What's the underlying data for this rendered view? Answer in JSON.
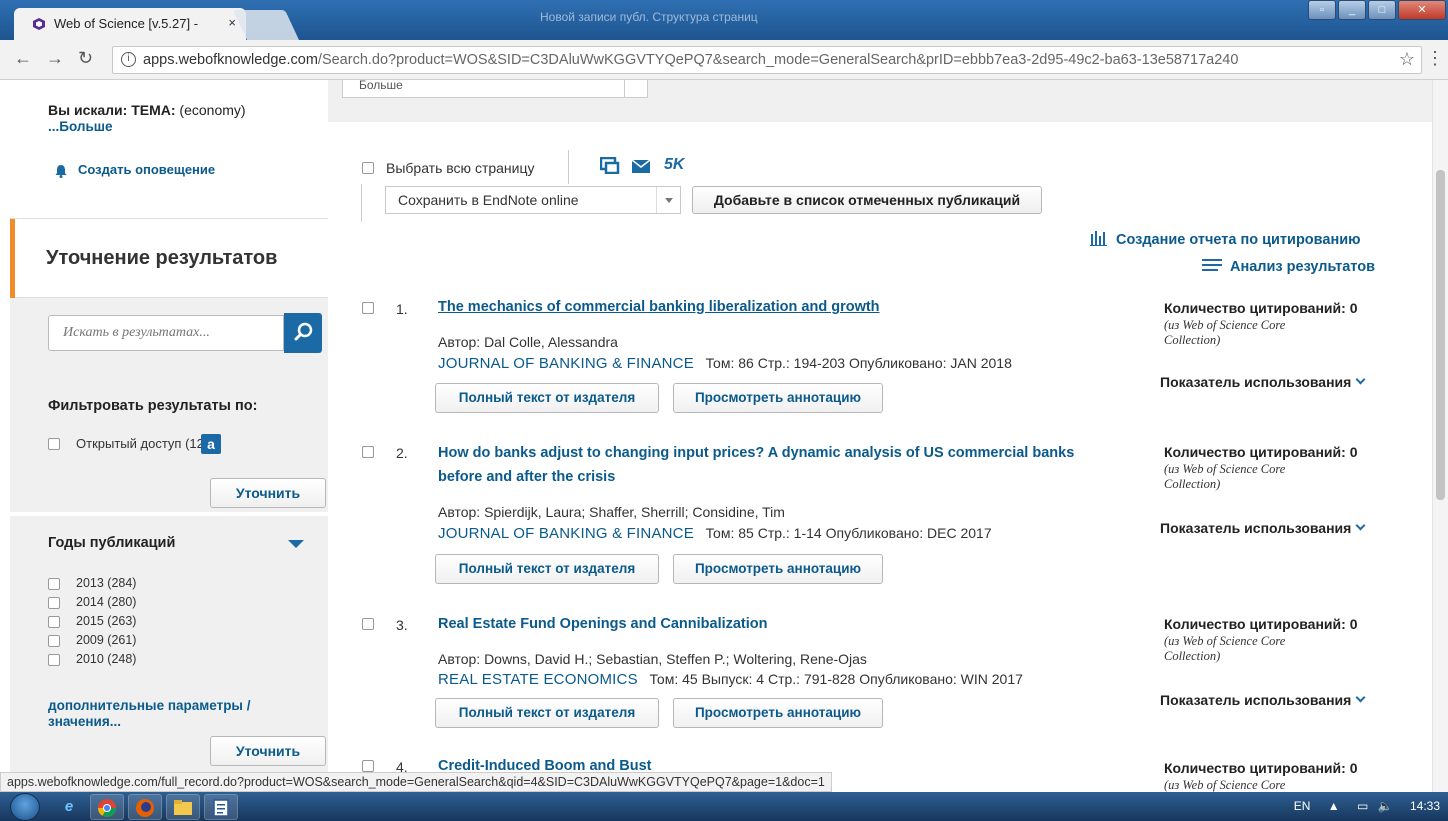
{
  "browser": {
    "tab_title": "Web of Science [v.5.27] -",
    "tab_close": "×",
    "window_title": "Новой записи публ. Структура страниц",
    "url_host": "apps.webofknowledge.com",
    "url_rest": "/Search.do?product=WOS&SID=C3DAluWwKGGVTYQePQ7&search_mode=GeneralSearch&prID=ebbb7ea3-2d95-49c2-ba63-13e58717a240",
    "status_url": "apps.webofknowledge.com/full_record.do?product=WOS&search_mode=GeneralSearch&qid=4&SID=C3DAluWwKGGVTYQePQ7&page=1&doc=1"
  },
  "sidebar": {
    "searched_label": "Вы искали: ТЕМА:",
    "searched_query": "(economy)",
    "more_label": "...Больше",
    "alert_label": "Создать оповещение",
    "refine_title": "Уточнение результатов",
    "search_placeholder": "Искать в результатах...",
    "filter_title": "Фильтровать результаты по:",
    "open_access_label": "Открытый доступ (126)",
    "refine_button": "Уточнить",
    "years_title": "Годы публикаций",
    "years": [
      "2013 (284)",
      "2014 (280)",
      "2015 (263)",
      "2009 (261)",
      "2010 (248)"
    ],
    "more_params": "дополнительные параметры / значения...",
    "refine_button2": "Уточнить"
  },
  "main": {
    "top_select_value": "Больше",
    "select_all_label": "Выбрать всю страницу",
    "five_k": "5K",
    "save_select_value": "Сохранить в EndNote online",
    "add_to_list_button": "Добавьте в список отмеченных публикаций",
    "citation_report": "Создание отчета по цитированию",
    "analyze_results": "Анализ результатов",
    "full_text_button": "Полный текст от издателя",
    "abstract_button": "Просмотреть аннотацию",
    "cites_label": "Количество цитирований: 0",
    "cites_source": "(из Web of Science Core Collection)",
    "usage_label": "Показатель использования",
    "records": [
      {
        "num": "1.",
        "title": "The mechanics of commercial banking liberalization and growth",
        "author": "Автор: Dal Colle, Alessandra",
        "journal": "JOURNAL OF BANKING & FINANCE",
        "details": "Том: 86  Стр.: 194-203  Опубликовано: JAN 2018"
      },
      {
        "num": "2.",
        "title": "How do banks adjust to changing input prices? A dynamic analysis of US commercial banks before and after the crisis",
        "author": "Автор: Spierdijk, Laura; Shaffer, Sherrill; Considine, Tim",
        "journal": "JOURNAL OF BANKING & FINANCE",
        "details": "Том: 85  Стр.: 1-14  Опубликовано: DEC 2017"
      },
      {
        "num": "3.",
        "title": "Real Estate Fund Openings and Cannibalization",
        "author": "Автор: Downs, David H.; Sebastian, Steffen P.; Woltering, Rene-Ojas",
        "journal": "REAL ESTATE ECONOMICS",
        "details": "Том: 45  Выпуск: 4  Стр.: 791-828  Опубликовано: WIN 2017"
      },
      {
        "num": "4.",
        "title": "Credit-Induced Boom and Bust",
        "cites_label": "Количество цитирований: 0",
        "cites_source": "(из Web of Science Core"
      }
    ]
  },
  "taskbar": {
    "lang": "EN",
    "time": "14:33"
  },
  "colors": {
    "accent": "#1b6aa5",
    "link": "#0b5a8c",
    "refine_bar": "#f28c28",
    "panel": "#f0f0f0"
  }
}
